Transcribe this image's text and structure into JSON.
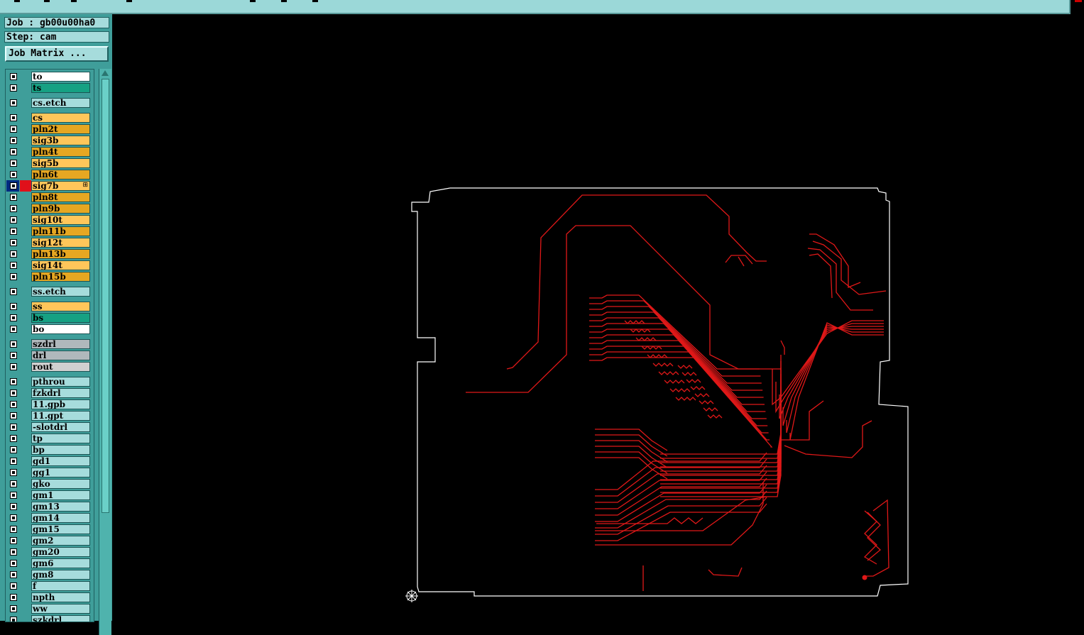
{
  "header": {
    "job_label": "Job : gb00u00ha0",
    "step_label": "Step: cam",
    "job_matrix_button": "Job Matrix ..."
  },
  "layers": [
    {
      "name": "to",
      "color": "#ffffff"
    },
    {
      "name": "ts",
      "color": "#16a183"
    },
    {
      "name": "cs.etch",
      "color": "#a6dcdc"
    },
    {
      "name": "cs",
      "color": "#ffc65a"
    },
    {
      "name": "pln2t",
      "color": "#e6a722"
    },
    {
      "name": "sig3b",
      "color": "#ffc65a"
    },
    {
      "name": "pln4t",
      "color": "#e6a722"
    },
    {
      "name": "sig5b",
      "color": "#ffc65a"
    },
    {
      "name": "pln6t",
      "color": "#e6a722"
    },
    {
      "name": "sig7b",
      "color": "#ffc65a",
      "active": true,
      "affected": true
    },
    {
      "name": "pln8t",
      "color": "#e6a722"
    },
    {
      "name": "pln9b",
      "color": "#e6a722"
    },
    {
      "name": "sig10t",
      "color": "#ffc65a"
    },
    {
      "name": "pln11b",
      "color": "#e6a722"
    },
    {
      "name": "sig12t",
      "color": "#ffc65a"
    },
    {
      "name": "pln13b",
      "color": "#e6a722"
    },
    {
      "name": "sig14t",
      "color": "#ffc65a"
    },
    {
      "name": "pln15b",
      "color": "#e6a722"
    },
    {
      "name": "ss.etch",
      "color": "#a6dcdc"
    },
    {
      "name": "ss",
      "color": "#ffc65a"
    },
    {
      "name": "bs",
      "color": "#16a183"
    },
    {
      "name": "bo",
      "color": "#ffffff"
    },
    {
      "name": "szdrl",
      "color": "#b0b8bc"
    },
    {
      "name": "drl",
      "color": "#b0b8bc"
    },
    {
      "name": "rout",
      "color": "#d0d0d0"
    },
    {
      "name": "pthrou",
      "color": "#a6dcdc"
    },
    {
      "name": "fzkdrl",
      "color": "#a6dcdc"
    },
    {
      "name": "11.gpb",
      "color": "#a6dcdc"
    },
    {
      "name": "11.gpt",
      "color": "#a6dcdc"
    },
    {
      "name": "-slotdrl",
      "color": "#a6dcdc"
    },
    {
      "name": "tp",
      "color": "#a6dcdc"
    },
    {
      "name": "bp",
      "color": "#a6dcdc"
    },
    {
      "name": "gd1",
      "color": "#a6dcdc"
    },
    {
      "name": "gg1",
      "color": "#a6dcdc"
    },
    {
      "name": "gko",
      "color": "#a6dcdc"
    },
    {
      "name": "gm1",
      "color": "#a6dcdc"
    },
    {
      "name": "gm13",
      "color": "#a6dcdc"
    },
    {
      "name": "gm14",
      "color": "#a6dcdc"
    },
    {
      "name": "gm15",
      "color": "#a6dcdc"
    },
    {
      "name": "gm2",
      "color": "#a6dcdc"
    },
    {
      "name": "gm20",
      "color": "#a6dcdc"
    },
    {
      "name": "gm6",
      "color": "#a6dcdc"
    },
    {
      "name": "gm8",
      "color": "#a6dcdc"
    },
    {
      "name": "f",
      "color": "#a6dcdc"
    },
    {
      "name": "npth",
      "color": "#a6dcdc"
    },
    {
      "name": "ww",
      "color": "#a6dcdc"
    },
    {
      "name": "szkdrl",
      "color": "#a6dcdc"
    }
  ],
  "colors": {
    "outline": "#ffffff",
    "trace": "#e01818",
    "panel": "#3f9e9a",
    "background": "#000000"
  },
  "icons": {
    "origin": "crosshair-icon",
    "checkbox": "checkbox-icon"
  }
}
